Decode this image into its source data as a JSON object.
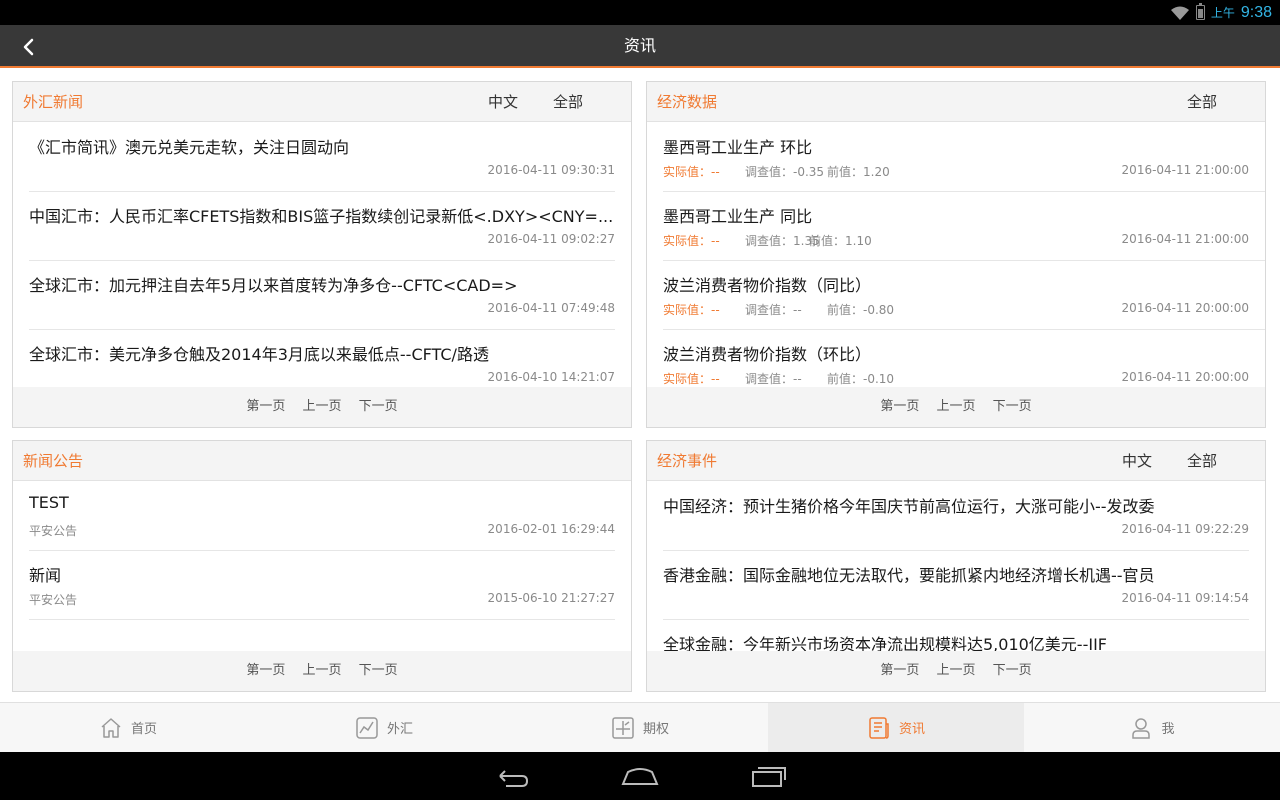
{
  "status_bar": {
    "ampm": "上午",
    "time": "9:38"
  },
  "header": {
    "title": "资讯"
  },
  "forex_news": {
    "title": "外汇新闻",
    "filter_lang": "中文",
    "filter_all": "全部",
    "items": [
      {
        "title": "《汇市简讯》澳元兑美元走软，关注日圆动向",
        "time": "2016-04-11 09:30:31"
      },
      {
        "title": "中国汇市：人民币汇率CFETS指数和BIS篮子指数续创记录新低<.DXY><CNY=...",
        "time": "2016-04-11 09:02:27"
      },
      {
        "title": "全球汇市：加元押注自去年5月以来首度转为净多仓--CFTC<CAD=>",
        "time": "2016-04-11 07:49:48"
      },
      {
        "title": "全球汇市：美元净多仓触及2014年3月底以来最低点--CFTC/路透",
        "time": "2016-04-10 14:21:07"
      }
    ],
    "pager": {
      "first": "第一页",
      "prev": "上一页",
      "next": "下一页"
    }
  },
  "econ_data": {
    "title": "经济数据",
    "filter_all": "全部",
    "items": [
      {
        "title": "墨西哥工业生产 环比",
        "actual": "实际值：--",
        "survey": "调查值：-0.35",
        "prev": "前值：1.20",
        "time": "2016-04-11 21:00:00"
      },
      {
        "title": "墨西哥工业生产 同比",
        "actual": "实际值：--",
        "survey": "调查值：1.35",
        "prev": "前值：1.10",
        "time": "2016-04-11 21:00:00"
      },
      {
        "title": "波兰消费者物价指数（同比）",
        "actual": "实际值：--",
        "survey": "调查值：--",
        "prev": "前值：-0.80",
        "time": "2016-04-11 20:00:00"
      },
      {
        "title": "波兰消费者物价指数（环比）",
        "actual": "实际值：--",
        "survey": "调查值：--",
        "prev": "前值：-0.10",
        "time": "2016-04-11 20:00:00"
      }
    ],
    "pager": {
      "first": "第一页",
      "prev": "上一页",
      "next": "下一页"
    }
  },
  "announcements": {
    "title": "新闻公告",
    "items": [
      {
        "title": "TEST",
        "source": "平安公告",
        "time": "2016-02-01 16:29:44"
      },
      {
        "title": "新闻",
        "source": "平安公告",
        "time": "2015-06-10 21:27:27"
      }
    ],
    "pager": {
      "first": "第一页",
      "prev": "上一页",
      "next": "下一页"
    }
  },
  "econ_events": {
    "title": "经济事件",
    "filter_lang": "中文",
    "filter_all": "全部",
    "items": [
      {
        "title": "中国经济：预计生猪价格今年国庆节前高位运行，大涨可能小--发改委",
        "time": "2016-04-11 09:22:29"
      },
      {
        "title": "香港金融：国际金融地位无法取代，要能抓紧内地经济增长机遇--官员",
        "time": "2016-04-11 09:14:54"
      },
      {
        "title": "全球金融：今年新兴市场资本净流出规模料达5,010亿美元--IIF",
        "time": ""
      }
    ],
    "pager": {
      "first": "第一页",
      "prev": "上一页",
      "next": "下一页"
    }
  },
  "tabs": [
    {
      "label": "首页",
      "icon": "home-icon"
    },
    {
      "label": "外汇",
      "icon": "chart-icon"
    },
    {
      "label": "期权",
      "icon": "options-icon"
    },
    {
      "label": "资讯",
      "icon": "news-icon"
    },
    {
      "label": "我",
      "icon": "user-icon"
    }
  ],
  "colors": {
    "accent": "#f07a32",
    "title_bar": "#383838",
    "status_blue": "#33b5e5"
  }
}
